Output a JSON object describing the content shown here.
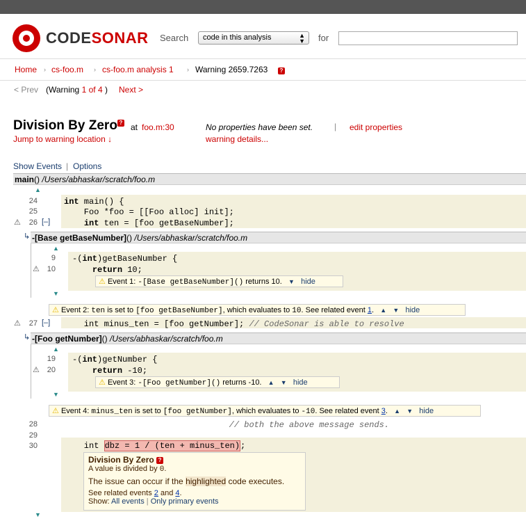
{
  "header": {
    "logo_code": "CODE",
    "logo_sonar": "SONAR",
    "search_label": "Search",
    "search_scope": "code in this analysis",
    "for_label": "for",
    "search_placeholder": ""
  },
  "breadcrumb": {
    "home": "Home",
    "file": "cs-foo.m",
    "analysis": "cs-foo.m analysis 1",
    "current": "Warning 2659.7263",
    "help": "?"
  },
  "pager": {
    "prev": "< Prev",
    "warning_prefix": "(Warning ",
    "current": "1",
    "of": " of ",
    "total": "4",
    "close_paren": " )",
    "next": "Next >"
  },
  "warning": {
    "title": "Division By Zero",
    "help": "?",
    "at": "at",
    "location": "foo.m:30",
    "jump": "Jump to warning location ↓",
    "no_props": "No properties have been set.",
    "edit_props": "edit properties",
    "details": "warning details..."
  },
  "toolbar": {
    "show_events": "Show Events",
    "options": "Options"
  },
  "main_fn": {
    "name": "main",
    "parens": "()",
    "path": "/Users/abhaskar/scratch/foo.m"
  },
  "code_main": [
    {
      "num": "24",
      "text": "int main() {"
    },
    {
      "num": "25",
      "text": "    Foo *foo = [[Foo alloc] init];"
    },
    {
      "num": "26",
      "text": "    int ten = [foo getBaseNumber];"
    }
  ],
  "collapse": "[–]",
  "fn_base": {
    "name": "-[Base getBaseNumber]",
    "parens": "()",
    "path": "/Users/abhaskar/scratch/foo.m",
    "lines": [
      {
        "num": "9",
        "text": "-(int)getBaseNumber {"
      },
      {
        "num": "10",
        "text": "    return 10;"
      }
    ]
  },
  "event1": {
    "label": "Event 1:",
    "code": "-[Base getBaseNumber]()",
    "text": " returns 10.",
    "hide": "hide"
  },
  "event2": {
    "label": "Event 2:",
    "code1": "ten",
    "t1": " is set to ",
    "code2": "[foo getBaseNumber]",
    "t2": ", which evaluates to ",
    "code3": "10",
    "t3": ". See related event ",
    "link": "1",
    "t4": ".",
    "hide": "hide"
  },
  "line27": {
    "num": "27",
    "code": "    int minus_ten = [foo getNumber];",
    "comment": " // CodeSonar is able to resolve"
  },
  "fn_foo": {
    "name": "-[Foo getNumber]",
    "parens": "()",
    "path": "/Users/abhaskar/scratch/foo.m",
    "lines": [
      {
        "num": "19",
        "text": "-(int)getNumber {"
      },
      {
        "num": "20",
        "text": "    return -10;"
      }
    ]
  },
  "event3": {
    "label": "Event 3:",
    "code": "-[Foo getNumber]()",
    "text": " returns -10.",
    "hide": "hide"
  },
  "event4": {
    "label": "Event 4:",
    "code1": "minus_ten",
    "t1": " is set to ",
    "code2": "[foo getNumber]",
    "t2": ", which evaluates to ",
    "code3": "-10",
    "t3": ". See related event ",
    "link": "3",
    "t4": ".",
    "hide": "hide"
  },
  "tail_lines": [
    {
      "num": "28",
      "text": "                                 // both the above message sends."
    },
    {
      "num": "29",
      "text": ""
    },
    {
      "num": "30",
      "text": ""
    }
  ],
  "line30": {
    "pre": "    int ",
    "hl": "dbz = 1 / (ten + minus_ten)",
    "post": ";"
  },
  "popup": {
    "title": "Division By Zero",
    "help": "?",
    "desc_pre": "A value is divided by ",
    "desc_code": "0",
    "desc_post": ".",
    "occur_pre": "The issue can occur if the ",
    "occur_hl": "highlighted",
    "occur_post": " code executes.",
    "related_pre": "See related events ",
    "ev_a": "2",
    "and": " and ",
    "ev_b": "4",
    "related_post": ".",
    "show": "Show:",
    "all_events": "All events",
    "primary": "Only primary events"
  },
  "colors": {
    "brand": "#cc0000",
    "highlight": "#f3f0dc",
    "event_bg": "#fffbe6"
  }
}
